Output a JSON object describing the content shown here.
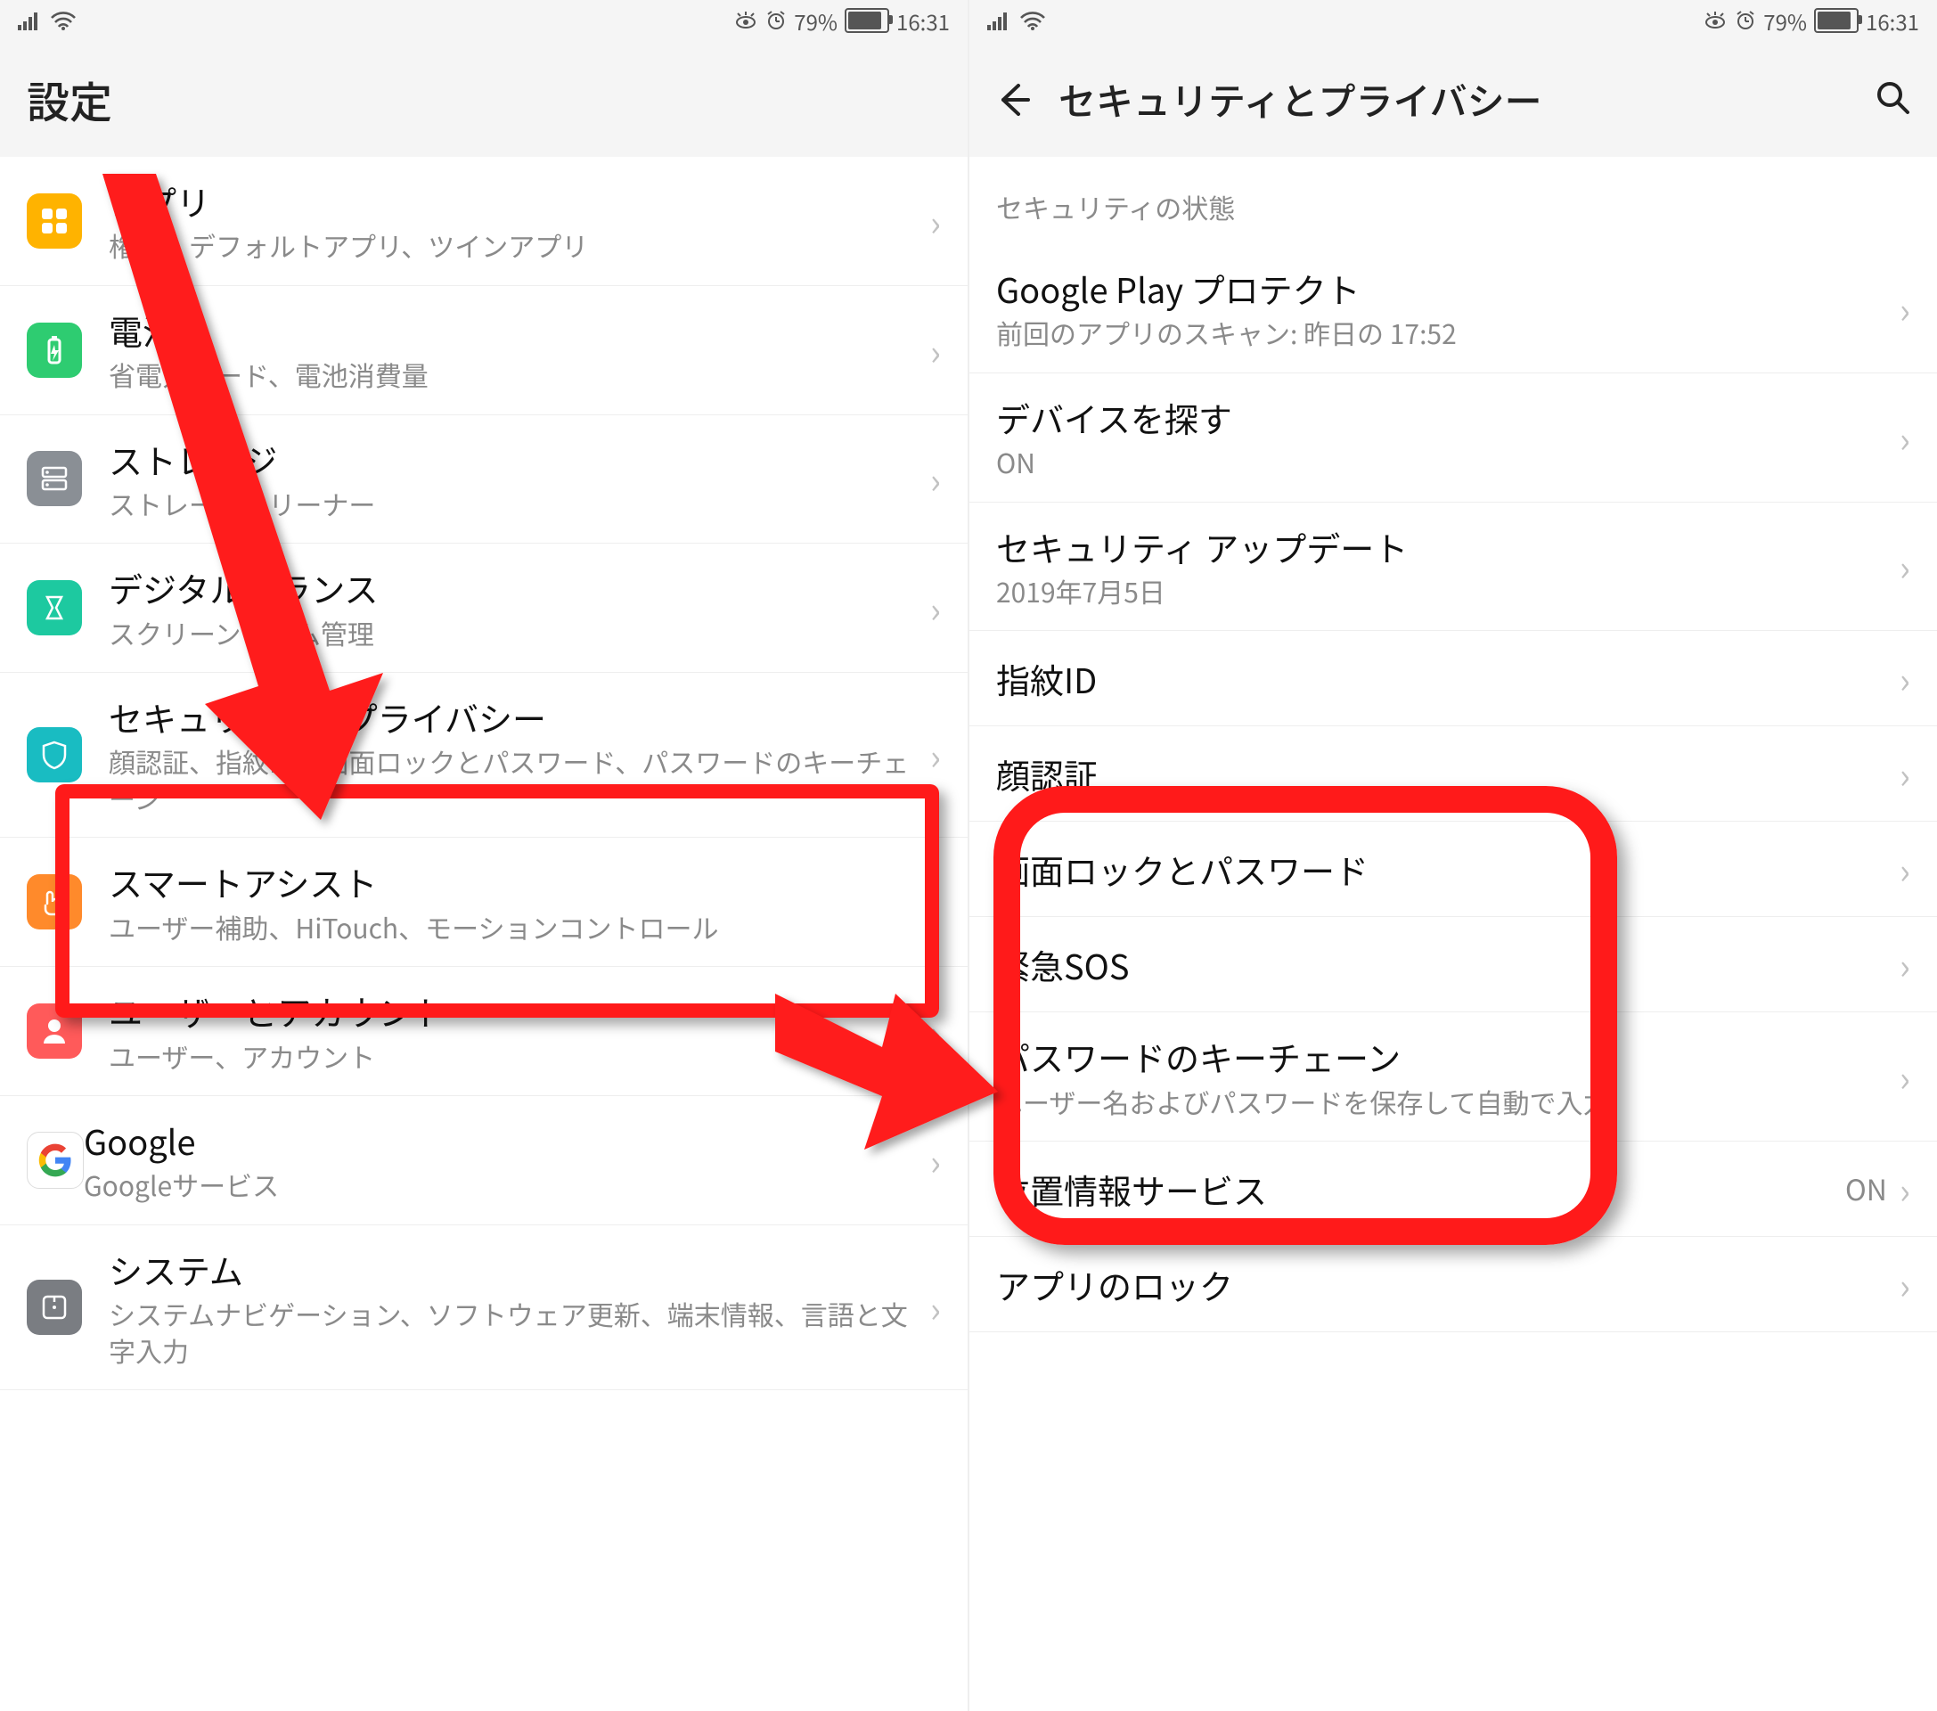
{
  "status": {
    "battery_pct": "79%",
    "time": "16:31"
  },
  "left": {
    "title": "設定",
    "items": [
      {
        "icon": "apps",
        "bg": "bg-orange",
        "title": "アプリ",
        "sub": "権限、デフォルトアプリ、ツインアプリ"
      },
      {
        "icon": "battery",
        "bg": "bg-green",
        "title": "電池",
        "sub": "省電力モード、電池消費量"
      },
      {
        "icon": "storage",
        "bg": "bg-gray",
        "title": "ストレージ",
        "sub": "ストレージクリーナー"
      },
      {
        "icon": "digital",
        "bg": "bg-teal",
        "title": "デジタルバランス",
        "sub": "スクリーンタイム管理"
      },
      {
        "icon": "security",
        "bg": "bg-cyan",
        "title": "セキュリティとプライバシー",
        "sub": "顔認証、指紋ID、画面ロックとパスワード、パスワードのキーチェーン"
      },
      {
        "icon": "smart",
        "bg": "bg-orangedeep",
        "title": "スマートアシスト",
        "sub": "ユーザー補助、HiTouch、モーションコントロール"
      },
      {
        "icon": "user",
        "bg": "bg-red",
        "title": "ユーザーとアカウント",
        "sub": "ユーザー、アカウント"
      },
      {
        "icon": "google",
        "bg": "bg-google",
        "title": "Google",
        "sub": "Googleサービス"
      },
      {
        "icon": "system",
        "bg": "bg-dark",
        "title": "システム",
        "sub": "システムナビゲーション、ソフトウェア更新、端末情報、言語と文字入力"
      }
    ]
  },
  "right": {
    "title": "セキュリティとプライバシー",
    "section": "セキュリティの状態",
    "items": [
      {
        "title": "Google Play プロテクト",
        "sub": "前回のアプリのスキャン: 昨日の 17:52"
      },
      {
        "title": "デバイスを探す",
        "sub": "ON"
      },
      {
        "title": "セキュリティ アップデート",
        "sub": "2019年7月5日"
      },
      {
        "title": "指紋ID",
        "sub": ""
      },
      {
        "title": "顔認証",
        "sub": ""
      },
      {
        "title": "画面ロックとパスワード",
        "sub": ""
      },
      {
        "title": "緊急SOS",
        "sub": ""
      },
      {
        "title": "パスワードのキーチェーン",
        "sub": "ユーザー名およびパスワードを保存して自動で入力"
      },
      {
        "title": "位置情報サービス",
        "sub": "",
        "val": "ON"
      },
      {
        "title": "アプリのロック",
        "sub": ""
      }
    ]
  }
}
